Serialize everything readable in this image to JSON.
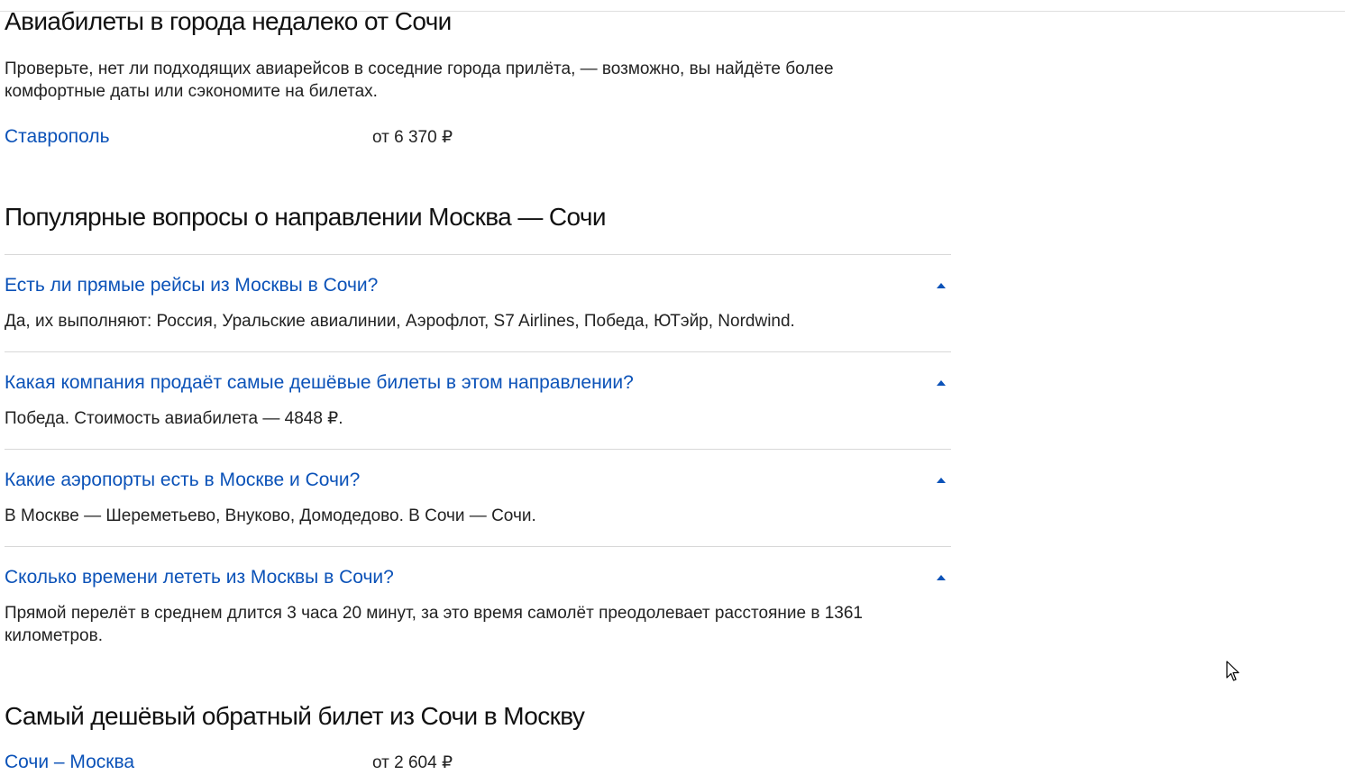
{
  "nearby": {
    "title": "Авиабилеты в города недалеко от Сочи",
    "description": "Проверьте, нет ли подходящих авиарейсов в соседние города прилёта, — возможно, вы найдёте более комфортные даты или сэкономите на билетах.",
    "items": [
      {
        "city": "Ставрополь",
        "price": "от 6 370 ₽"
      }
    ]
  },
  "faq": {
    "title": "Популярные вопросы о направлении Москва — Сочи",
    "items": [
      {
        "question": "Есть ли прямые рейсы из Москвы в Сочи?",
        "answer": "Да, их выполняют: Россия, Уральские авиалинии, Аэрофлот, S7 Airlines, Победа, ЮТэйр, Nordwind."
      },
      {
        "question": "Какая компания продаёт самые дешёвые билеты в этом направлении?",
        "answer": "Победа. Стоимость авиабилета — 4848 ₽."
      },
      {
        "question": "Какие аэропорты есть в Москве и Сочи?",
        "answer": "В Москве — Шереметьево, Внуково, Домодедово. В Сочи — Сочи."
      },
      {
        "question": "Сколько времени лететь из Москвы в Сочи?",
        "answer": "Прямой перелёт в среднем длится 3 часа 20 минут, за это время самолёт преодолевает расстояние в 1361 километров."
      }
    ],
    "chevron_icon": "chevron-up-icon"
  },
  "return_ticket": {
    "title": "Самый дешёвый обратный билет из Сочи в Москву",
    "items": [
      {
        "route": "Сочи – Москва",
        "price": "от 2 604 ₽"
      }
    ]
  },
  "colors": {
    "link": "#0b52b8",
    "text": "#222222",
    "divider": "#d8d8d8"
  }
}
